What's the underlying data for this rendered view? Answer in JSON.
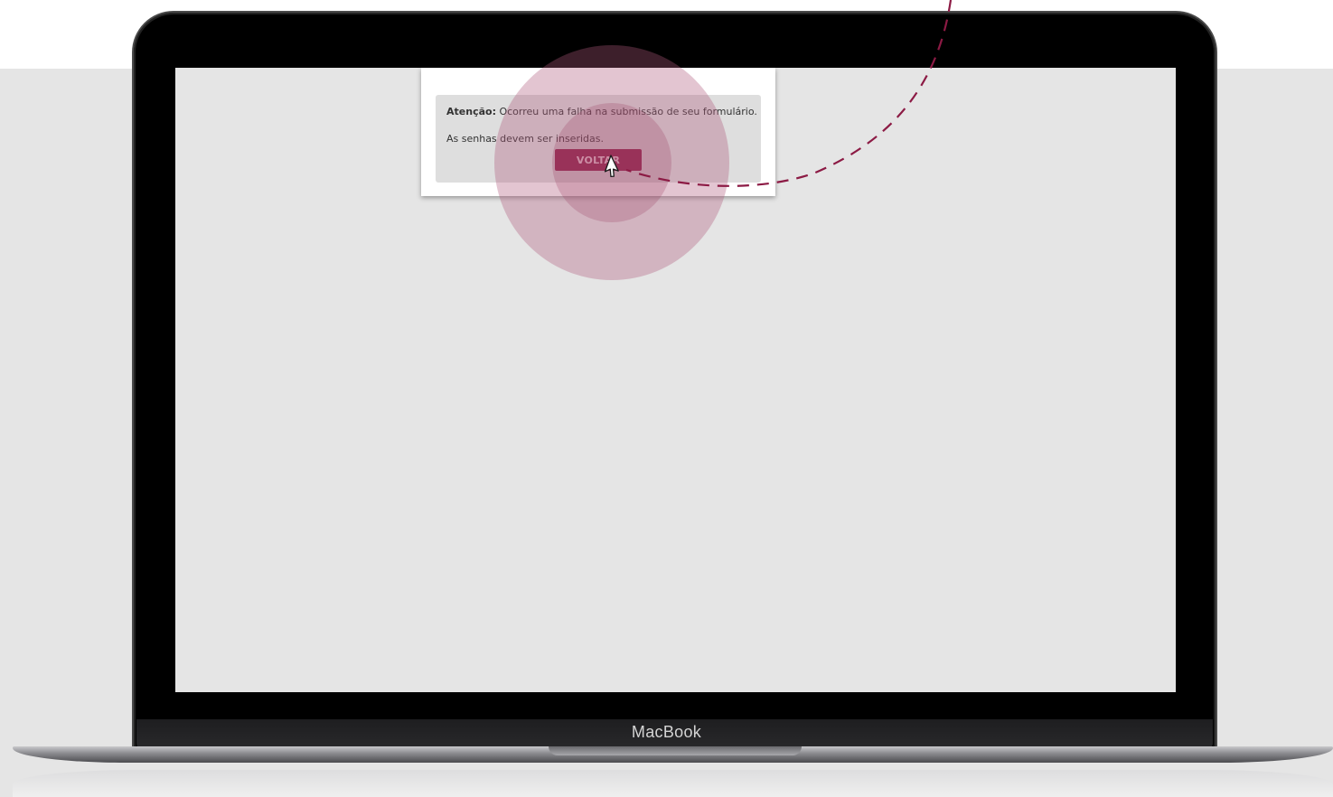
{
  "device": {
    "brand_label": "MacBook"
  },
  "dialog": {
    "alert": {
      "title": "Atenção:",
      "message": "Ocorreu uma falha na submissão de seu formulário.",
      "detail": "As senhas devem ser inseridas."
    },
    "back_button_label": "VOLTAR"
  },
  "theme": {
    "accent": "#8c1a44",
    "screen_background": "#e5e5e5",
    "alert_background": "#dedede",
    "highlight_ring": "#c8849c"
  },
  "annotation": {
    "cursor_icon": "pointer-cursor-icon",
    "click_highlight": "click-ripple",
    "path": "dashed-motion-path"
  }
}
